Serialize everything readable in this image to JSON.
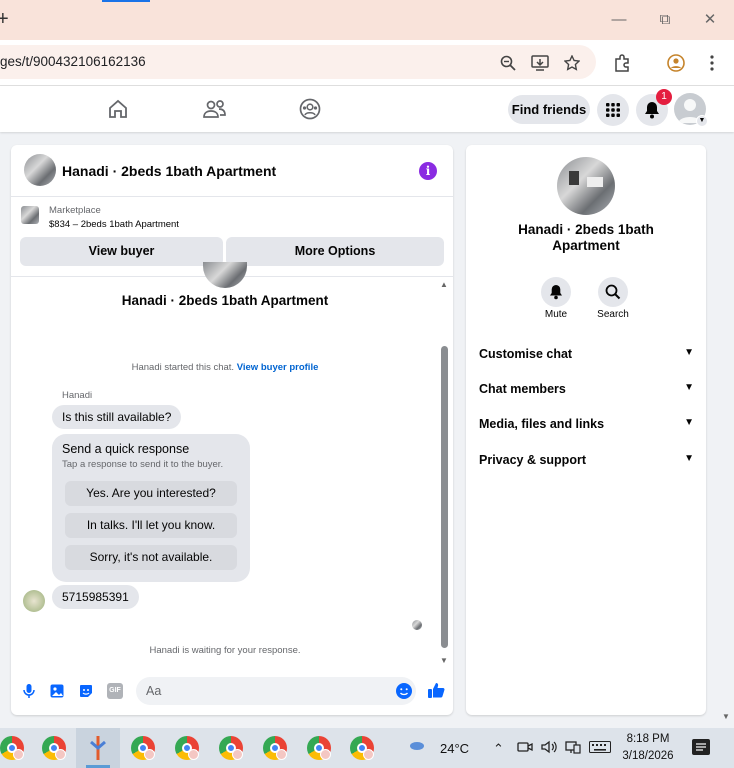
{
  "browser": {
    "url": "ges/t/900432106162136",
    "new_tab": "+"
  },
  "nav": {
    "find_friends": "Find friends",
    "notification_count": "1"
  },
  "chat": {
    "title": "Hanadi · 2beds 1bath Apartment",
    "marketplace_label": "Marketplace",
    "listing": "$834 – 2beds 1bath Apartment",
    "view_buyer": "View buyer",
    "more_options": "More Options",
    "seller_heading": "Hanadi · 2beds 1bath Apartment",
    "started_text": "Hanadi started this chat.",
    "view_buyer_profile": "View buyer profile",
    "sender": "Hanadi",
    "message1": "Is this still available?",
    "quick_title": "Send a quick response",
    "quick_sub": "Tap a response to send it to the buyer.",
    "quick_options": [
      "Yes. Are you interested?",
      "In talks. I'll let you know.",
      "Sorry, it's not available."
    ],
    "message2": "5715985391",
    "waiting": "Hanadi is waiting for your response.",
    "input_placeholder": "Aa",
    "gif_label": "GIF"
  },
  "info": {
    "name": "Hanadi · 2beds 1bath Apartment",
    "mute": "Mute",
    "search": "Search",
    "sections": [
      "Customise chat",
      "Chat members",
      "Media, files and links",
      "Privacy & support"
    ]
  },
  "taskbar": {
    "temperature": "24°C",
    "time": "8:18 PM",
    "date": "3/18/2026"
  },
  "colors": {
    "accent": "#0866ff",
    "info_icon": "#8a2be2",
    "badge": "#e41e3f"
  }
}
